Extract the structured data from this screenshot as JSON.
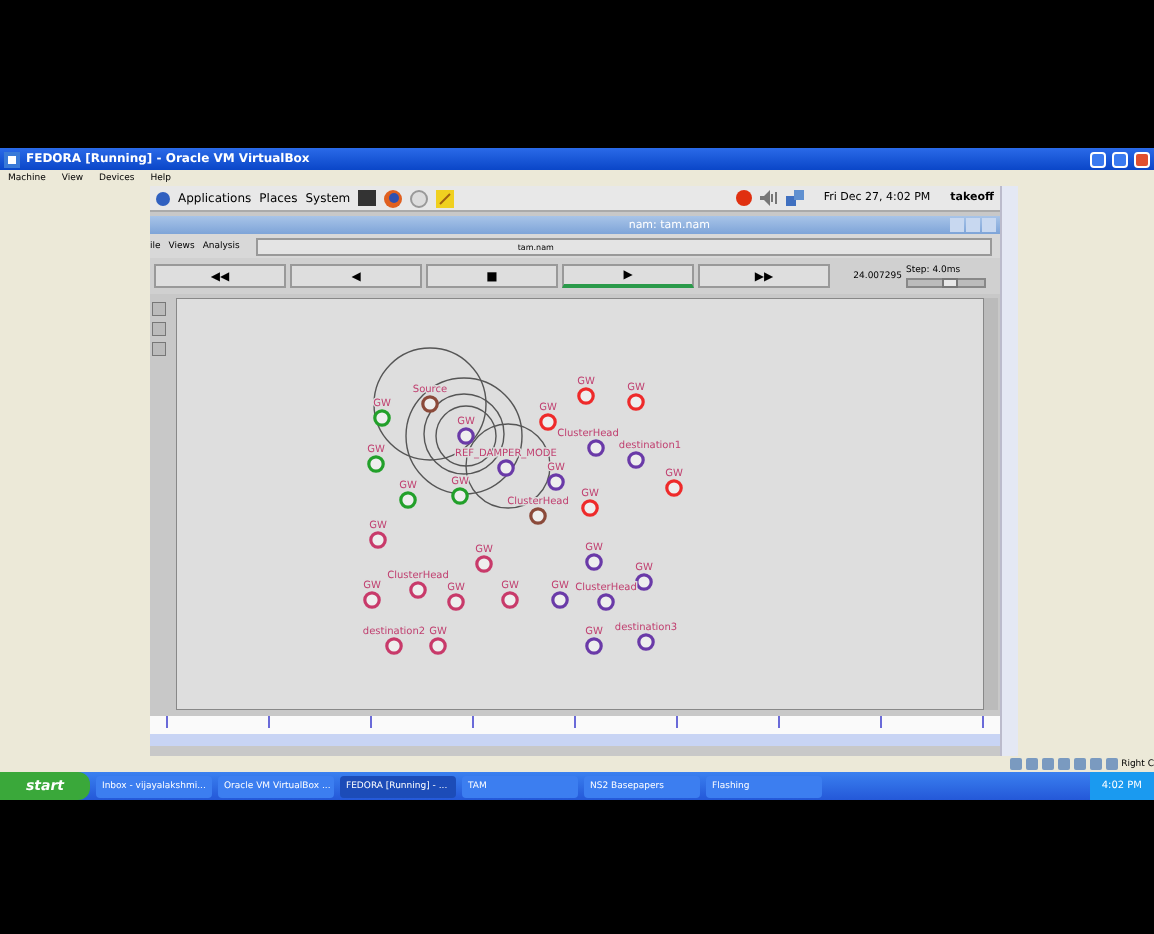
{
  "vm_window": {
    "title": "FEDORA [Running] - Oracle VM VirtualBox",
    "menu": [
      "Machine",
      "View",
      "Devices",
      "Help"
    ],
    "host_key": "Right C"
  },
  "guest_panel": {
    "menus": [
      "Applications",
      "Places",
      "System"
    ],
    "clock": "Fri Dec 27,  4:02 PM",
    "user": "takeoff"
  },
  "nam": {
    "title": "nam: tam.nam",
    "menu": [
      "ile",
      "Views",
      "Analysis"
    ],
    "file": "tam.nam",
    "controls": [
      {
        "symbol": "◀◀",
        "selected": false
      },
      {
        "symbol": "◀",
        "selected": false
      },
      {
        "symbol": "■",
        "selected": false
      },
      {
        "symbol": "▶",
        "selected": true
      },
      {
        "symbol": "▶▶",
        "selected": false
      }
    ],
    "time": "24.007295",
    "step": "Step: 4.0ms",
    "step_slider": {
      "level": 0.55
    },
    "nodes": [
      {
        "label": "Source",
        "color": "#8b4a3a"
      },
      {
        "label": "GW",
        "color": "#22a02a"
      },
      {
        "label": "GW",
        "color": "#22a02a"
      },
      {
        "label": "GW",
        "color": "#6a3aa8"
      },
      {
        "label": "GW",
        "color": "#ee2a2a"
      },
      {
        "label": "GW",
        "color": "#ee2a2a"
      },
      {
        "label": "GW",
        "color": "#ee2a2a"
      },
      {
        "label": "ClusterHead",
        "color": "#6a3aa8"
      },
      {
        "label": "destination1",
        "color": "#6a3aa8"
      },
      {
        "label": "REF_DAMPER_MODE",
        "color": "#6a3aa8"
      },
      {
        "label": "GW",
        "color": "#6a3aa8"
      },
      {
        "label": "GW",
        "color": "#22a02a"
      },
      {
        "label": "GW",
        "color": "#22a02a"
      },
      {
        "label": "ClusterHead",
        "color": "#8b4a3a"
      },
      {
        "label": "GW",
        "color": "#ee2a2a"
      },
      {
        "label": "GW",
        "color": "#ee2a2a"
      },
      {
        "label": "GW",
        "color": "#c83a6a"
      },
      {
        "label": "GW",
        "color": "#c83a6a"
      },
      {
        "label": "GW",
        "color": "#6a3aa8"
      },
      {
        "label": "GW",
        "color": "#6a3aa8"
      },
      {
        "label": "GW",
        "color": "#c83a6a"
      },
      {
        "label": "ClusterHead",
        "color": "#c83a6a"
      },
      {
        "label": "GW",
        "color": "#c83a6a"
      },
      {
        "label": "GW",
        "color": "#c83a6a"
      },
      {
        "label": "GW",
        "color": "#6a3aa8"
      },
      {
        "label": "ClusterHead",
        "color": "#6a3aa8"
      },
      {
        "label": "destination2",
        "color": "#c83a6a"
      },
      {
        "label": "GW",
        "color": "#c83a6a"
      },
      {
        "label": "GW",
        "color": "#6a3aa8"
      },
      {
        "label": "destination3",
        "color": "#6a3aa8"
      }
    ]
  },
  "taskbar": {
    "start": "start",
    "items": [
      {
        "label": "Inbox - vijayalakshmi...",
        "selected": false
      },
      {
        "label": "Oracle VM VirtualBox ...",
        "selected": false
      },
      {
        "label": "FEDORA [Running] - ...",
        "selected": true
      },
      {
        "label": "TAM",
        "selected": false
      },
      {
        "label": "NS2 Basepapers",
        "selected": false
      },
      {
        "label": "Flashing",
        "selected": false
      }
    ],
    "clock": "4:02 PM"
  }
}
